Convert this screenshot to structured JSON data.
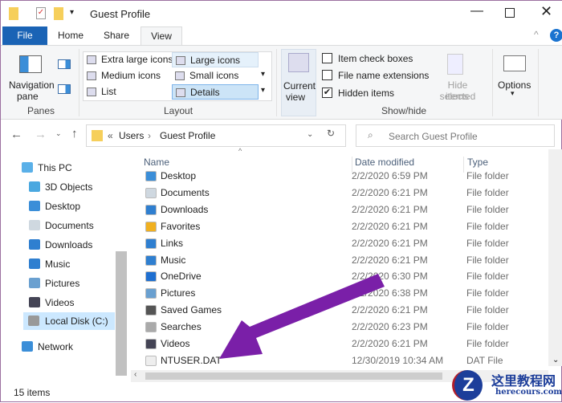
{
  "window": {
    "title": "Guest Profile"
  },
  "tabs": [
    "File",
    "Home",
    "Share",
    "View"
  ],
  "ribbon": {
    "panes": {
      "navigation_pane": "Navigation",
      "navigation_pane2": "pane",
      "group": "Panes"
    },
    "layout": {
      "items": [
        "Extra large icons",
        "Large icons",
        "Medium icons",
        "Small icons",
        "List",
        "Details"
      ],
      "group": "Layout"
    },
    "current_view": {
      "line1": "Current",
      "line2": "view"
    },
    "show_hide": {
      "item_check_boxes": "Item check boxes",
      "file_name_extensions": "File name extensions",
      "hidden_items": "Hidden items",
      "hide_selected1": "Hide selected",
      "hide_selected2": "items",
      "group": "Show/hide"
    },
    "options": "Options"
  },
  "address": {
    "prefix": "«",
    "crumbs": [
      "Users",
      "Guest Profile"
    ],
    "search_placeholder": "Search Guest Profile"
  },
  "nav": [
    "This PC",
    "3D Objects",
    "Desktop",
    "Documents",
    "Downloads",
    "Music",
    "Pictures",
    "Videos",
    "Local Disk (C:)",
    "Network"
  ],
  "columns": {
    "name": "Name",
    "date": "Date modified",
    "type": "Type"
  },
  "files": [
    {
      "name": "Desktop",
      "date": "2/2/2020 6:59 PM",
      "type": "File folder",
      "color": "#3b8ed8"
    },
    {
      "name": "Documents",
      "date": "2/2/2020 6:21 PM",
      "type": "File folder",
      "color": "#cfd8e0"
    },
    {
      "name": "Downloads",
      "date": "2/2/2020 6:21 PM",
      "type": "File folder",
      "color": "#2f7fd0"
    },
    {
      "name": "Favorites",
      "date": "2/2/2020 6:21 PM",
      "type": "File folder",
      "color": "#f0b020"
    },
    {
      "name": "Links",
      "date": "2/2/2020 6:21 PM",
      "type": "File folder",
      "color": "#2f7fd0"
    },
    {
      "name": "Music",
      "date": "2/2/2020 6:21 PM",
      "type": "File folder",
      "color": "#2f7fd0"
    },
    {
      "name": "OneDrive",
      "date": "2/2/2020 6:30 PM",
      "type": "File folder",
      "color": "#1f6fd0"
    },
    {
      "name": "Pictures",
      "date": "2/2/2020 6:38 PM",
      "type": "File folder",
      "color": "#6aa0d0"
    },
    {
      "name": "Saved Games",
      "date": "2/2/2020 6:21 PM",
      "type": "File folder",
      "color": "#555"
    },
    {
      "name": "Searches",
      "date": "2/2/2020 6:23 PM",
      "type": "File folder",
      "color": "#aaa"
    },
    {
      "name": "Videos",
      "date": "2/2/2020 6:21 PM",
      "type": "File folder",
      "color": "#445"
    },
    {
      "name": "NTUSER.DAT",
      "date": "12/30/2019 10:34 AM",
      "type": "DAT File",
      "color": "#eee"
    }
  ],
  "status": {
    "count": "15 items"
  },
  "watermark": {
    "cn": "这里教程网",
    "url": "herecours.com"
  },
  "colors": {
    "accent": "#1a63b5",
    "arrow": "#7a1fa8"
  }
}
